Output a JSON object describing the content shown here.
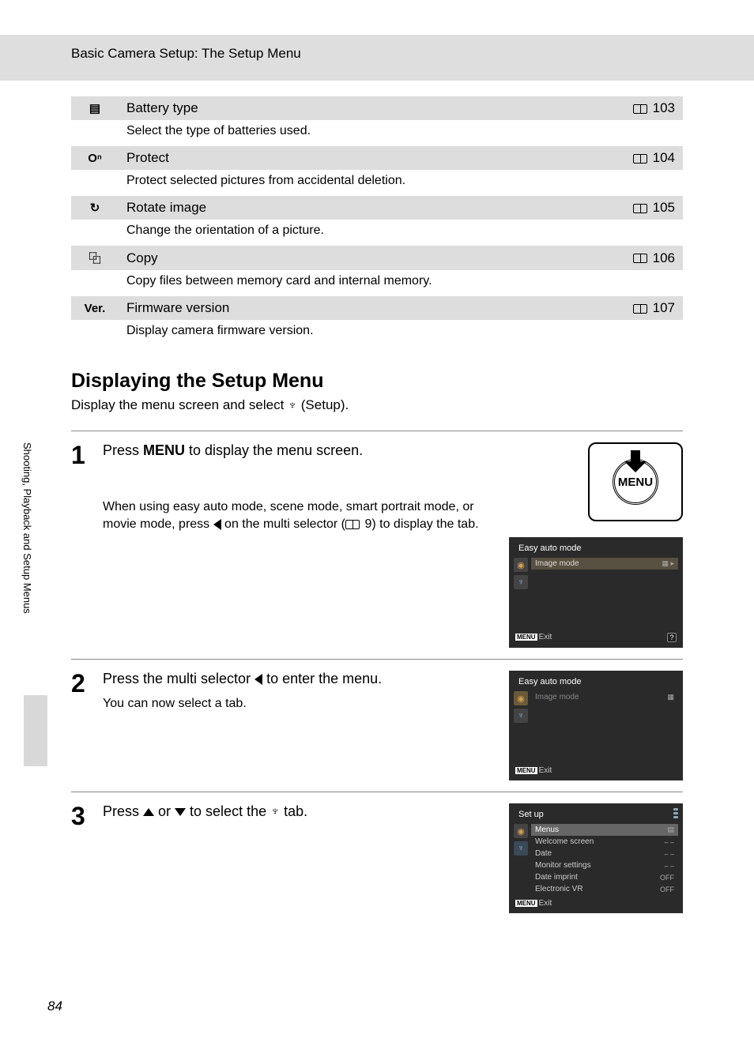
{
  "header": "Basic Camera Setup: The Setup Menu",
  "side_label": "Shooting, Playback and Setup Menus",
  "table": [
    {
      "icon": "battery",
      "icon_text": "▤",
      "name": "Battery type",
      "page": "103",
      "desc": "Select the type of batteries used."
    },
    {
      "icon": "protect",
      "icon_text": "Oⁿ",
      "name": "Protect",
      "page": "104",
      "desc": "Protect selected pictures from accidental deletion."
    },
    {
      "icon": "rotate",
      "icon_text": "↻",
      "name": "Rotate image",
      "page": "105",
      "desc": "Change the orientation of a picture."
    },
    {
      "icon": "copy",
      "icon_text": "⿻",
      "name": "Copy",
      "page": "106",
      "desc": "Copy files between memory card and internal memory."
    },
    {
      "icon": "version",
      "icon_text": "Ver.",
      "name": "Firmware version",
      "page": "107",
      "desc": "Display camera firmware version."
    }
  ],
  "section": {
    "heading": "Displaying the Setup Menu",
    "intro_a": "Display the menu screen and select ",
    "intro_b": " (Setup)."
  },
  "steps": {
    "s1": {
      "num": "1",
      "title_a": "Press ",
      "title_b": "MENU",
      "title_c": " to display the menu screen.",
      "desc_a": "When using easy auto mode, scene mode, smart portrait mode, or movie mode, press ",
      "desc_b": " on the multi selector (",
      "desc_c": " 9) to display the tab.",
      "menu_btn_label": "MENU",
      "lcd_title": "Easy auto mode",
      "lcd_row": "Image mode",
      "lcd_exit": "Exit"
    },
    "s2": {
      "num": "2",
      "title_a": "Press the multi selector ",
      "title_b": " to enter the menu.",
      "desc": "You can now select a tab.",
      "lcd_title": "Easy auto mode",
      "lcd_row": "Image mode",
      "lcd_exit": "Exit"
    },
    "s3": {
      "num": "3",
      "title_a": "Press ",
      "title_b": " or ",
      "title_c": " to select the ",
      "title_d": " tab.",
      "lcd_title": "Set up",
      "rows": [
        {
          "label": "Menus",
          "val": "▤"
        },
        {
          "label": "Welcome screen",
          "val": "– –"
        },
        {
          "label": "Date",
          "val": "– –"
        },
        {
          "label": "Monitor settings",
          "val": "– –"
        },
        {
          "label": "Date imprint",
          "val": "OFF"
        },
        {
          "label": "Electronic VR",
          "val": "OFF"
        }
      ],
      "lcd_exit": "Exit"
    }
  },
  "page_number": "84"
}
